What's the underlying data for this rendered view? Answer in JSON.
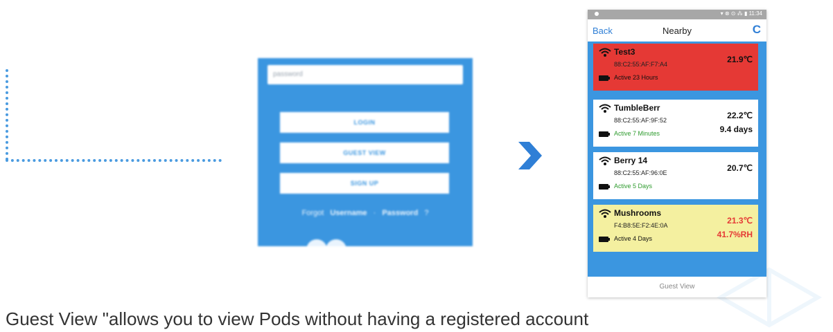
{
  "login": {
    "password_placeholder": "password",
    "login_button": "LOGIN",
    "guest_button": "GUEST VIEW",
    "signup_button": "SIGN UP",
    "forgot_prefix": "Forgot",
    "forgot_username": "Username",
    "forgot_sep": "·",
    "forgot_password": "Password",
    "forgot_suffix": "?"
  },
  "phone": {
    "status_text": "▾ ⊗ ⊙ ⁂ ▮ 11:34",
    "back_label": "Back",
    "title": "Nearby",
    "refresh_icon": "refresh-icon",
    "pods": [
      {
        "name": "Test3",
        "mac": "88:C2:55:AF:F7:A4",
        "active": "Active 23 Hours",
        "temp": "21.9℃",
        "extra": "",
        "bg": "#e53935",
        "active_color": "#111111",
        "temp_color": "#111111",
        "extra_color": "#111111"
      },
      {
        "name": "TumbleBerr",
        "mac": "88:C2:55:AF:9F:52",
        "active": "Active 7 Minutes",
        "temp": "22.2℃",
        "extra": "9.4 days",
        "bg": "#ffffff",
        "active_color": "#2e9b2e",
        "temp_color": "#111111",
        "extra_color": "#111111"
      },
      {
        "name": "Berry 14",
        "mac": "88:C2:55:AF:96:0E",
        "active": "Active 5 Days",
        "temp": "20.7℃",
        "extra": "",
        "bg": "#ffffff",
        "active_color": "#2e9b2e",
        "temp_color": "#111111",
        "extra_color": "#111111"
      },
      {
        "name": "Mushrooms",
        "mac": "F4:B8:5E:F2:4E:0A",
        "active": "Active 4 Days",
        "temp": "21.3℃",
        "extra": "41.7%RH",
        "bg": "#f4f0a0",
        "active_color": "#111111",
        "temp_color": "#e53935",
        "extra_color": "#e53935"
      }
    ],
    "bottom_label": "Guest View"
  },
  "caption": "Guest View \"allows you to view Pods without having a registered account",
  "colors": {
    "accent": "#3b96e0",
    "arrow": "#2f7fd6"
  }
}
